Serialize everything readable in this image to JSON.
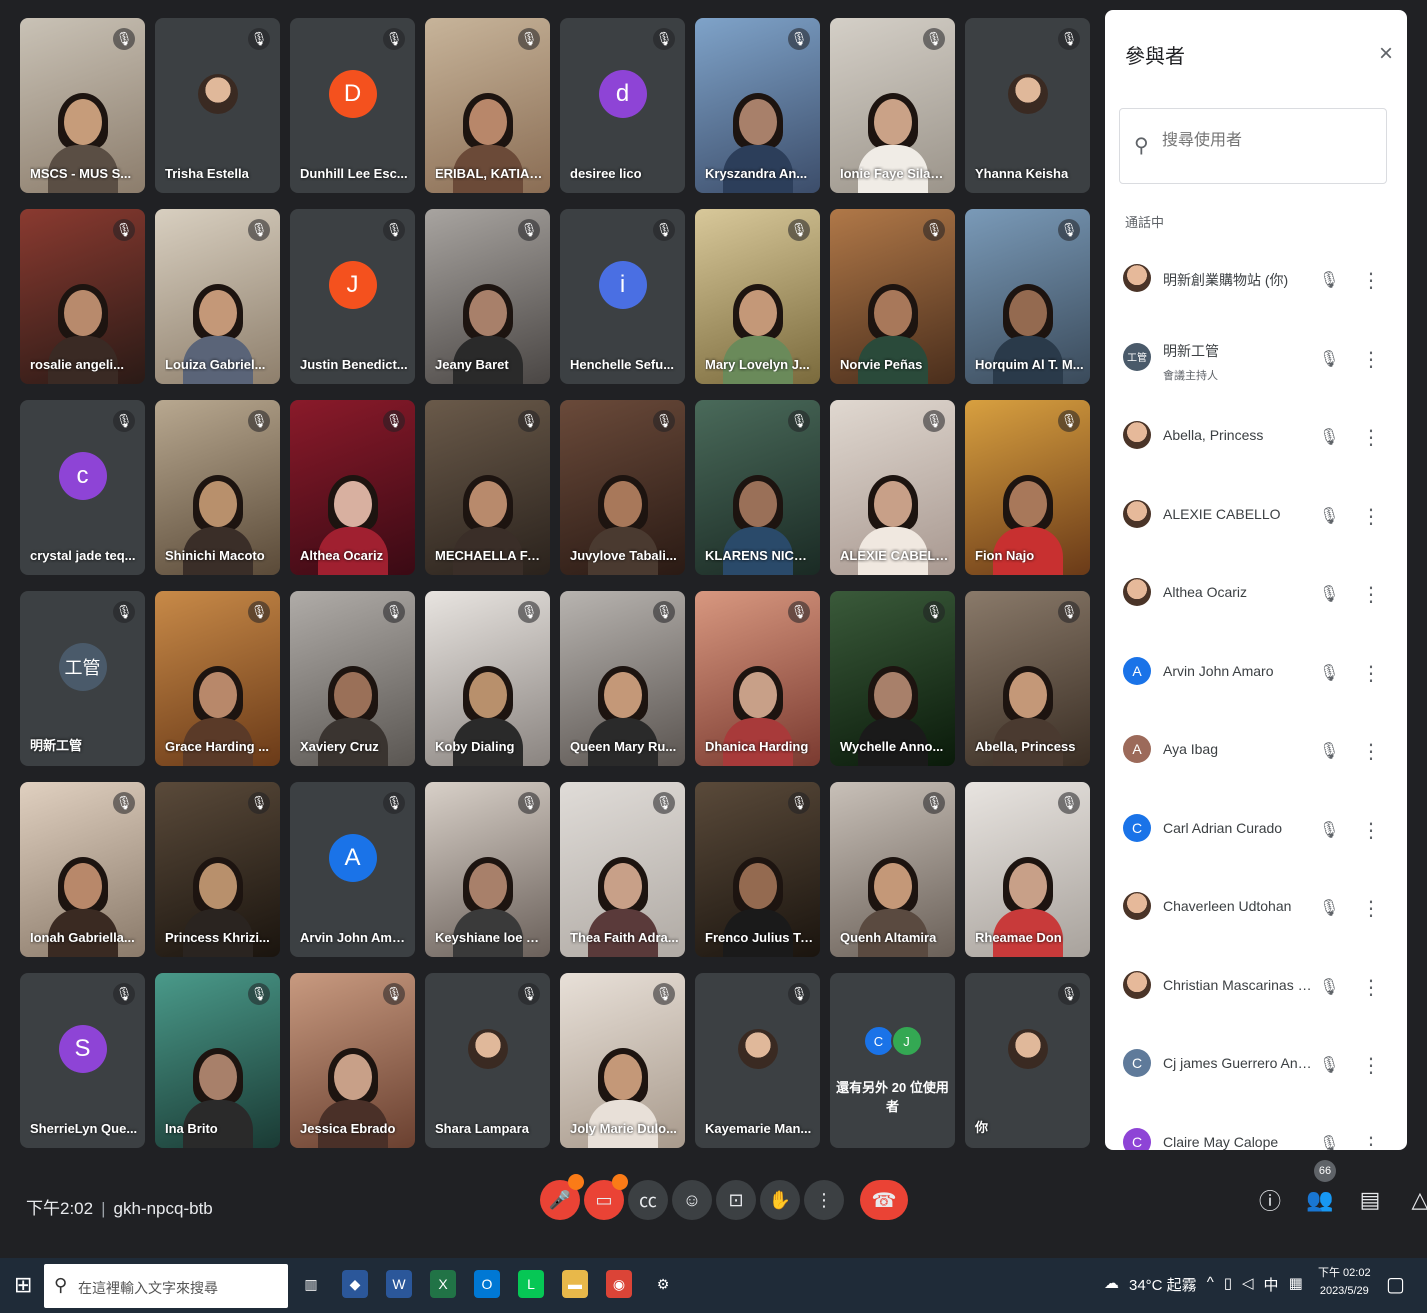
{
  "tiles": [
    {
      "name": "MSCS - MUS S...",
      "type": "cam",
      "c1": "#c9c2b6",
      "c2": "#8c7d6c",
      "skin": "#c69c7a",
      "shirt": "#5a4e44"
    },
    {
      "name": "Trisha Estella",
      "type": "pic"
    },
    {
      "name": "Dunhill Lee Esc...",
      "type": "letter",
      "letter": "D",
      "color": "#f4511e"
    },
    {
      "name": "ERIBAL, KATIAN...",
      "type": "cam",
      "c1": "#c7b49a",
      "c2": "#8a6d54",
      "skin": "#b8876a",
      "shirt": "#6b4a38"
    },
    {
      "name": "desiree lico",
      "type": "letter",
      "letter": "d",
      "color": "#8e44d6"
    },
    {
      "name": "Kryszandra An...",
      "type": "cam",
      "c1": "#7fa3c9",
      "c2": "#3c4d6a",
      "skin": "#a8806a",
      "shirt": "#2c3e5a"
    },
    {
      "name": "Ionie Faye Silan...",
      "type": "cam",
      "c1": "#d4cfc7",
      "c2": "#9b948a",
      "skin": "#caa287",
      "shirt": "#f0ece6"
    },
    {
      "name": "Yhanna Keisha",
      "type": "pic"
    },
    {
      "name": "rosalie angeli...",
      "type": "cam",
      "c1": "#8a3a30",
      "c2": "#2a1a16",
      "skin": "#b88a6c",
      "shirt": "#3a2a24"
    },
    {
      "name": "Louiza Gabriel...",
      "type": "cam",
      "c1": "#d8cfc0",
      "c2": "#8e7f6c",
      "skin": "#c49878",
      "shirt": "#5a6478"
    },
    {
      "name": "Justin Benedict...",
      "type": "letter",
      "letter": "J",
      "color": "#f4511e"
    },
    {
      "name": "Jeany Baret",
      "type": "cam",
      "c1": "#a8a4a0",
      "c2": "#4a4644",
      "skin": "#a8806a",
      "shirt": "#2a2a2a"
    },
    {
      "name": "Henchelle Sefu...",
      "type": "letter",
      "letter": "i",
      "color": "#4a6fe3"
    },
    {
      "name": "Mary Lovelyn J...",
      "type": "cam",
      "c1": "#d8c89a",
      "c2": "#7a6a3c",
      "skin": "#c49878",
      "shirt": "#6a8a5a"
    },
    {
      "name": "Norvie Peñas",
      "type": "cam",
      "c1": "#b07848",
      "c2": "#4a2e1c",
      "skin": "#a8785a",
      "shirt": "#2a4a3a"
    },
    {
      "name": "Horquim Al T. M...",
      "type": "cam",
      "c1": "#7a9ab8",
      "c2": "#3a4a5a",
      "skin": "#946a50",
      "shirt": "#2a3a4a"
    },
    {
      "name": "crystal jade teq...",
      "type": "letter",
      "letter": "c",
      "color": "#8e44d6"
    },
    {
      "name": "Shinichi Macoto",
      "type": "cam",
      "c1": "#b8a890",
      "c2": "#5a4a38",
      "skin": "#b8906c",
      "shirt": "#3a2e28"
    },
    {
      "name": "Althea Ocariz",
      "type": "cam",
      "c1": "#8a1a2a",
      "c2": "#3a0a14",
      "skin": "#d8b0a0",
      "shirt": "#a02030"
    },
    {
      "name": "MECHAELLA FA...",
      "type": "cam",
      "c1": "#6a5a4a",
      "c2": "#2a221c",
      "skin": "#b88a6c",
      "shirt": "#3a2e28"
    },
    {
      "name": "Juvylove Tabali...",
      "type": "cam",
      "c1": "#6a4a3a",
      "c2": "#2a1a14",
      "skin": "#a8785a",
      "shirt": "#4a3a30"
    },
    {
      "name": "KLARENS NICO...",
      "type": "cam",
      "c1": "#4a6a5a",
      "c2": "#1a2a24",
      "skin": "#9a7058",
      "shirt": "#2a4a6a"
    },
    {
      "name": "ALEXIE CABELLO",
      "type": "cam",
      "c1": "#e0d8d0",
      "c2": "#a89890",
      "skin": "#c8a088",
      "shirt": "#f0e8e0"
    },
    {
      "name": "Fion Najo",
      "type": "cam",
      "c1": "#d8a040",
      "c2": "#6a3a18",
      "skin": "#a8785a",
      "shirt": "#c83030"
    },
    {
      "name": "明新工管",
      "type": "letter",
      "letter": "工管",
      "color": "#4a5a6a"
    },
    {
      "name": "Grace Harding ...",
      "type": "cam",
      "c1": "#c88a48",
      "c2": "#6a3a18",
      "skin": "#b8886a",
      "shirt": "#5a3a28"
    },
    {
      "name": "Xaviery Cruz",
      "type": "cam",
      "c1": "#b0aca8",
      "c2": "#5a5652",
      "skin": "#9a7058",
      "shirt": "#3a3430"
    },
    {
      "name": "Koby Dialing",
      "type": "cam",
      "c1": "#e8e4e0",
      "c2": "#8a8480",
      "skin": "#b8906c",
      "shirt": "#2a2a2a"
    },
    {
      "name": "Queen Mary Ru...",
      "type": "cam",
      "c1": "#b8b4b0",
      "c2": "#5a5450",
      "skin": "#c49878",
      "shirt": "#2a2a2a"
    },
    {
      "name": "Dhanica Harding",
      "type": "cam",
      "c1": "#d89880",
      "c2": "#7a3a30",
      "skin": "#c8a088",
      "shirt": "#a83a3a"
    },
    {
      "name": "Wychelle Anno...",
      "type": "cam",
      "c1": "#3a5a3a",
      "c2": "#0a1a0a",
      "skin": "#a8806a",
      "shirt": "#1a1a1a"
    },
    {
      "name": "Abella, Princess",
      "type": "cam",
      "c1": "#8a7a6a",
      "c2": "#3a2e24",
      "skin": "#c49878",
      "shirt": "#4a3a30"
    },
    {
      "name": "Ionah Gabriella...",
      "type": "cam",
      "c1": "#e0d0c0",
      "c2": "#8a7a6a",
      "skin": "#b8886a",
      "shirt": "#3a2a22"
    },
    {
      "name": "Princess Khrizi...",
      "type": "cam",
      "c1": "#5a4a3a",
      "c2": "#1a140e",
      "skin": "#b8906c",
      "shirt": "#2a2420"
    },
    {
      "name": "Arvin John Ama...",
      "type": "letter",
      "letter": "A",
      "color": "#1a73e8"
    },
    {
      "name": "Keyshiane loe B...",
      "type": "cam",
      "c1": "#d8d0c8",
      "c2": "#6a605a",
      "skin": "#a8806a",
      "shirt": "#3a3a3a"
    },
    {
      "name": "Thea Faith Adra...",
      "type": "cam",
      "c1": "#e0dcd8",
      "c2": "#b0aaa4",
      "skin": "#c8a088",
      "shirt": "#5a3a3a"
    },
    {
      "name": "Frenco Julius Tu...",
      "type": "cam",
      "c1": "#5a4a3a",
      "c2": "#1a140e",
      "skin": "#946a50",
      "shirt": "#1a1a1a"
    },
    {
      "name": "Quenh Altamira",
      "type": "cam",
      "c1": "#c8c0b8",
      "c2": "#6a6058",
      "skin": "#c49878",
      "shirt": "#5a4a40"
    },
    {
      "name": "Rheamae Don",
      "type": "cam",
      "c1": "#e8e4e0",
      "c2": "#a8a29c",
      "skin": "#c8a088",
      "shirt": "#c83a3a"
    },
    {
      "name": "SherrieLyn Que...",
      "type": "letter",
      "letter": "S",
      "color": "#8e44d6"
    },
    {
      "name": "Ina Brito",
      "type": "cam",
      "c1": "#4a9a8a",
      "c2": "#1a3a34",
      "skin": "#a8806a",
      "shirt": "#2a2a2a"
    },
    {
      "name": "Jessica Ebrado",
      "type": "cam",
      "c1": "#c89a80",
      "c2": "#6a4030",
      "skin": "#c8a088",
      "shirt": "#4a3028"
    },
    {
      "name": "Shara Lampara",
      "type": "pic"
    },
    {
      "name": "Joly Marie Dulo...",
      "type": "cam",
      "c1": "#e8e0d8",
      "c2": "#a89a8c",
      "skin": "#c49878",
      "shirt": "#e8e0d8"
    },
    {
      "name": "Kayemarie Man...",
      "type": "pic"
    },
    {
      "name": "還有另外 20 位使用者",
      "type": "more"
    },
    {
      "name": "你",
      "type": "pic"
    }
  ],
  "more_avatars": [
    {
      "letter": "C",
      "color": "#1a73e8"
    },
    {
      "letter": "J",
      "color": "#34a853"
    }
  ],
  "panel": {
    "title": "參與者",
    "close": "×",
    "search_placeholder": "搜尋使用者",
    "section": "通話中",
    "participants": [
      {
        "name": "明新創業購物站 (你)",
        "sub": "",
        "avatar": "photo",
        "letter": "",
        "color": ""
      },
      {
        "name": "明新工管",
        "sub": "會議主持人",
        "avatar": "letter",
        "letter": "工管",
        "color": "#4a5a6a"
      },
      {
        "name": "Abella, Princess",
        "sub": "",
        "avatar": "photo",
        "letter": "",
        "color": ""
      },
      {
        "name": "ALEXIE CABELLO",
        "sub": "",
        "avatar": "photo",
        "letter": "",
        "color": ""
      },
      {
        "name": "Althea Ocariz",
        "sub": "",
        "avatar": "photo",
        "letter": "",
        "color": ""
      },
      {
        "name": "Arvin John Amaro",
        "sub": "",
        "avatar": "letter",
        "letter": "A",
        "color": "#1a73e8"
      },
      {
        "name": "Aya Ibag",
        "sub": "",
        "avatar": "letter",
        "letter": "A",
        "color": "#9c6a5a"
      },
      {
        "name": "Carl Adrian Curado",
        "sub": "",
        "avatar": "letter",
        "letter": "C",
        "color": "#1a73e8"
      },
      {
        "name": "Chaverleen Udtohan",
        "sub": "",
        "avatar": "photo",
        "letter": "",
        "color": ""
      },
      {
        "name": "Christian Mascarinas Babia",
        "sub": "",
        "avatar": "photo",
        "letter": "",
        "color": ""
      },
      {
        "name": "Cj james Guerrero Angcos",
        "sub": "",
        "avatar": "letter",
        "letter": "C",
        "color": "#5f7a9a"
      },
      {
        "name": "Claire May Calope",
        "sub": "",
        "avatar": "letter",
        "letter": "C",
        "color": "#8e44d6"
      }
    ]
  },
  "bottom": {
    "time": "下午2:02",
    "meeting_code": "gkh-npcq-btb",
    "participant_count": "66"
  },
  "taskbar": {
    "search_placeholder": "在這裡輸入文字來搜尋",
    "weather": "34°C 起霧",
    "ime": "中",
    "clock_time": "下午 02:02",
    "clock_date": "2023/5/29"
  },
  "icons": {
    "mic_off": "mic-off-icon",
    "more": "more-vert-icon",
    "search": "search-icon"
  }
}
